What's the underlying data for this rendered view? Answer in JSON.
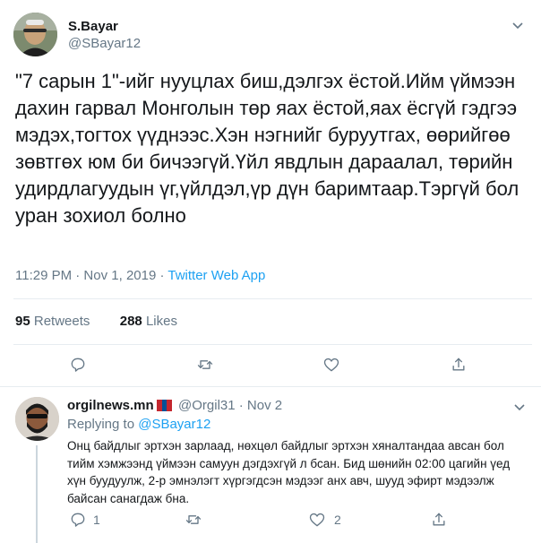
{
  "tweet": {
    "display_name": "S.Bayar",
    "handle": "@SBayar12",
    "text": "\"7 сарын 1\"-ийг нууцлах биш,дэлгэх ёстой.Ийм үймээн дахин гарвал Монголын төр яах ёстой,яах ёсгүй гэдгээ мэдэх,тогтох үүднээс.Хэн нэгнийг буруутгах, өөрийгөө зөвтгөх юм би бичээгүй.Үйл явдлын дараалал, төрийн удирдлагуудын үг,үйлдэл,үр дүн баримтаар.Тэргүй бол уран зохиол болно",
    "time": "11:29 PM · Nov 1, 2019 · ",
    "source_app": "Twitter Web App",
    "retweets_count": "95",
    "retweets_label": "Retweets",
    "likes_count": "288",
    "likes_label": "Likes"
  },
  "reply": {
    "display_name": "orgilnews.mn",
    "handle": "@Orgil31 · Nov 2",
    "replying_prefix": "Replying to ",
    "replying_to": "@SBayar12",
    "text": "Онц байдлыг эртхэн зарлаад, нөхцөл байдлыг эртхэн хяналтандаа авсан бол тийм хэмжээнд үймээн самуун дэгдэхгүй л бсан. Бид шөнийн 02:00 цагийн үед хүн буудуулж, 2-р эмнэлэгт хүргэгдсэн мэдээг анх авч, шууд эфирт мэдээлж байсан санагдаж бна.",
    "reply_count": "1",
    "like_count": "2"
  },
  "colors": {
    "accent": "#1da1f2",
    "secondary_text": "#657786",
    "primary_text": "#14171a",
    "divider": "#e6ecf0",
    "flag": [
      "#c4272f",
      "#015197",
      "#c4272f"
    ]
  },
  "icons": [
    "chevron-down-icon",
    "reply-icon",
    "retweet-icon",
    "like-icon",
    "share-icon",
    "flag-mongolia-icon"
  ]
}
